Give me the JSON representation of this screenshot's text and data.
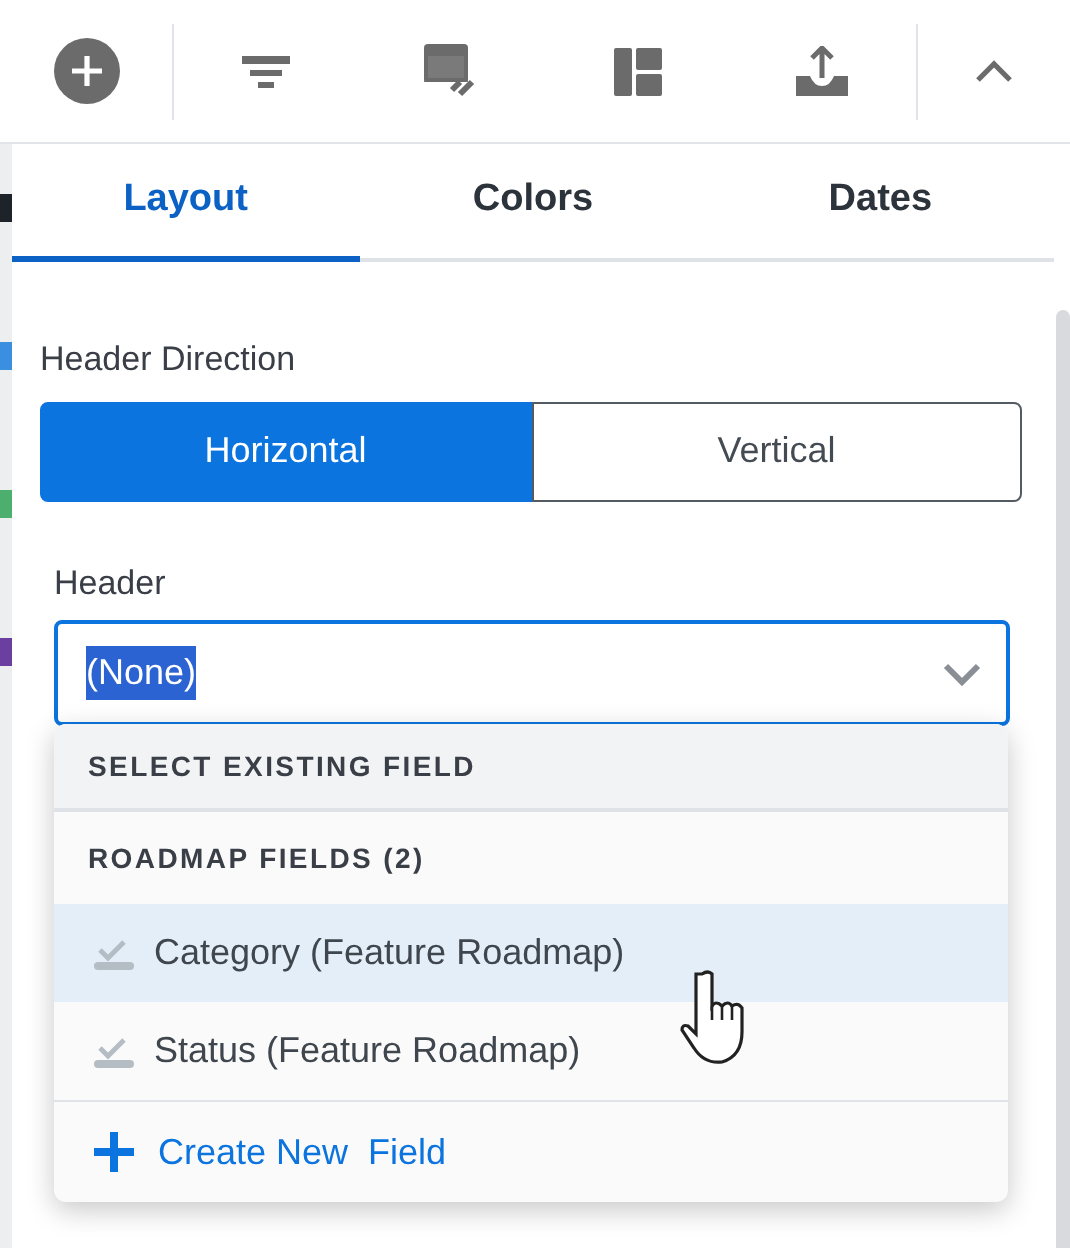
{
  "tabs": [
    {
      "label": "Layout",
      "selected": true
    },
    {
      "label": "Colors",
      "selected": false
    },
    {
      "label": "Dates",
      "selected": false
    }
  ],
  "header_direction": {
    "label": "Header Direction",
    "options": [
      {
        "label": "Horizontal",
        "selected": true
      },
      {
        "label": "Vertical",
        "selected": false
      }
    ]
  },
  "header": {
    "label": "Header",
    "value": "(None)",
    "text_selected": true,
    "expanded": true
  },
  "dropdown": {
    "section": "SELECT EXISTING FIELD",
    "group": "ROADMAP FIELDS (2)",
    "items": [
      {
        "label": "Category (Feature Roadmap)",
        "hovered": true
      },
      {
        "label": "Status (Feature Roadmap)",
        "hovered": false
      }
    ],
    "action": "Create New  Field"
  }
}
